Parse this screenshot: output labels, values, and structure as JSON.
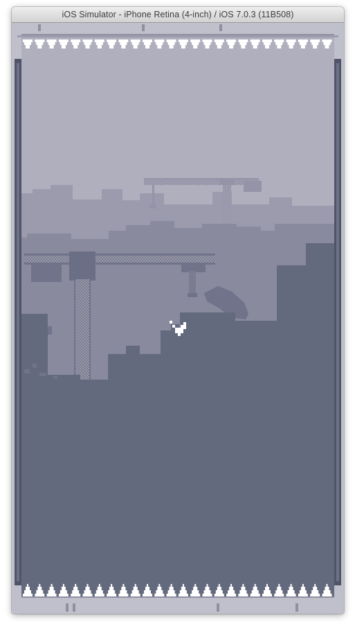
{
  "window": {
    "title": "iOS Simulator - iPhone Retina (4-inch) / iOS 7.0.3 (11B508)"
  },
  "game": {
    "icons": {
      "ceiling_spikes": "spike-row-icon",
      "floor_spikes": "spike-row-icon",
      "player": "bird-icon"
    },
    "colors": {
      "sky": "#b0afbe",
      "far_layer": "#9c9bad",
      "mid_layer": "#8a8a9f",
      "near_layer": "#646a7e",
      "frame": "#c0c0cd",
      "spikes": "#ffffff",
      "player": "#ffffff"
    }
  }
}
